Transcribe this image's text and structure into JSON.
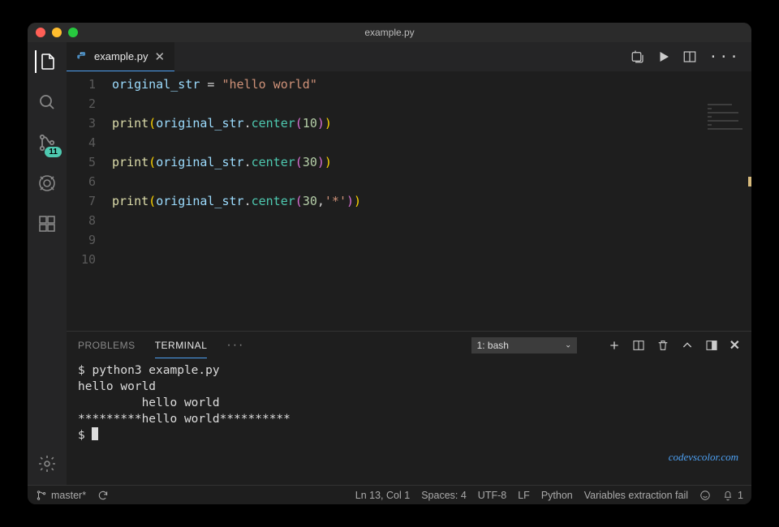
{
  "window": {
    "title": "example.py"
  },
  "activitybar": {
    "scm_badge": "11"
  },
  "tab": {
    "filename": "example.py"
  },
  "editor": {
    "line_numbers": [
      "1",
      "2",
      "3",
      "4",
      "5",
      "6",
      "7",
      "8",
      "9",
      "10"
    ],
    "lines": [
      {
        "tokens": [
          {
            "t": "original_str",
            "c": "tok-var"
          },
          {
            "t": " = ",
            "c": "tok-op"
          },
          {
            "t": "\"hello world\"",
            "c": "tok-str"
          }
        ]
      },
      {
        "tokens": []
      },
      {
        "tokens": [
          {
            "t": "print",
            "c": "tok-fn"
          },
          {
            "t": "(",
            "c": "tok-par"
          },
          {
            "t": "original_str",
            "c": "tok-var"
          },
          {
            "t": ".",
            "c": "tok-op"
          },
          {
            "t": "center",
            "c": "tok-call"
          },
          {
            "t": "(",
            "c": "tok-par2"
          },
          {
            "t": "10",
            "c": "tok-num"
          },
          {
            "t": ")",
            "c": "tok-par2"
          },
          {
            "t": ")",
            "c": "tok-par"
          }
        ]
      },
      {
        "tokens": []
      },
      {
        "tokens": [
          {
            "t": "print",
            "c": "tok-fn"
          },
          {
            "t": "(",
            "c": "tok-par"
          },
          {
            "t": "original_str",
            "c": "tok-var"
          },
          {
            "t": ".",
            "c": "tok-op"
          },
          {
            "t": "center",
            "c": "tok-call"
          },
          {
            "t": "(",
            "c": "tok-par2"
          },
          {
            "t": "30",
            "c": "tok-num"
          },
          {
            "t": ")",
            "c": "tok-par2"
          },
          {
            "t": ")",
            "c": "tok-par"
          }
        ]
      },
      {
        "tokens": []
      },
      {
        "tokens": [
          {
            "t": "print",
            "c": "tok-fn"
          },
          {
            "t": "(",
            "c": "tok-par"
          },
          {
            "t": "original_str",
            "c": "tok-var"
          },
          {
            "t": ".",
            "c": "tok-op"
          },
          {
            "t": "center",
            "c": "tok-call"
          },
          {
            "t": "(",
            "c": "tok-par2"
          },
          {
            "t": "30",
            "c": "tok-num"
          },
          {
            "t": ",",
            "c": "tok-op"
          },
          {
            "t": "'*'",
            "c": "tok-str"
          },
          {
            "t": ")",
            "c": "tok-par2"
          },
          {
            "t": ")",
            "c": "tok-par"
          }
        ]
      },
      {
        "tokens": []
      },
      {
        "tokens": []
      },
      {
        "tokens": []
      }
    ]
  },
  "panel": {
    "tabs": {
      "problems": "PROBLEMS",
      "terminal": "TERMINAL"
    },
    "terminal_select": "1: bash",
    "output": [
      "$ python3 example.py",
      "hello world",
      "         hello world",
      "*********hello world**********",
      "$ "
    ]
  },
  "statusbar": {
    "branch": "master*",
    "cursor": "Ln 13, Col 1",
    "spaces": "Spaces: 4",
    "encoding": "UTF-8",
    "eol": "LF",
    "lang": "Python",
    "msg": "Variables extraction fail",
    "notif": "1"
  },
  "watermark": "codevscolor.com"
}
